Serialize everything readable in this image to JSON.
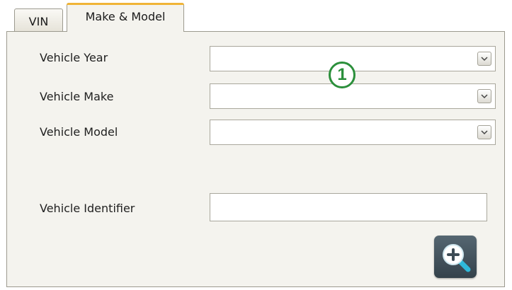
{
  "tabs": [
    {
      "label": "VIN",
      "active": false
    },
    {
      "label": "Make & Model",
      "active": true
    }
  ],
  "form": {
    "year_label": "Vehicle Year",
    "make_label": "Vehicle Make",
    "model_label": "Vehicle Model",
    "identifier_label": "Vehicle Identifier",
    "year_value": "",
    "make_value": "",
    "model_value": "",
    "identifier_value": ""
  },
  "annotation": {
    "marker_text": "1",
    "marker_color": "#2b8f3b"
  },
  "icons": {
    "dropdown": "chevron-down-icon",
    "search": "zoom-in-icon"
  },
  "colors": {
    "active_tab_accent": "#f0b437",
    "panel_background": "#f4f3ee",
    "search_button": "#43525c"
  }
}
